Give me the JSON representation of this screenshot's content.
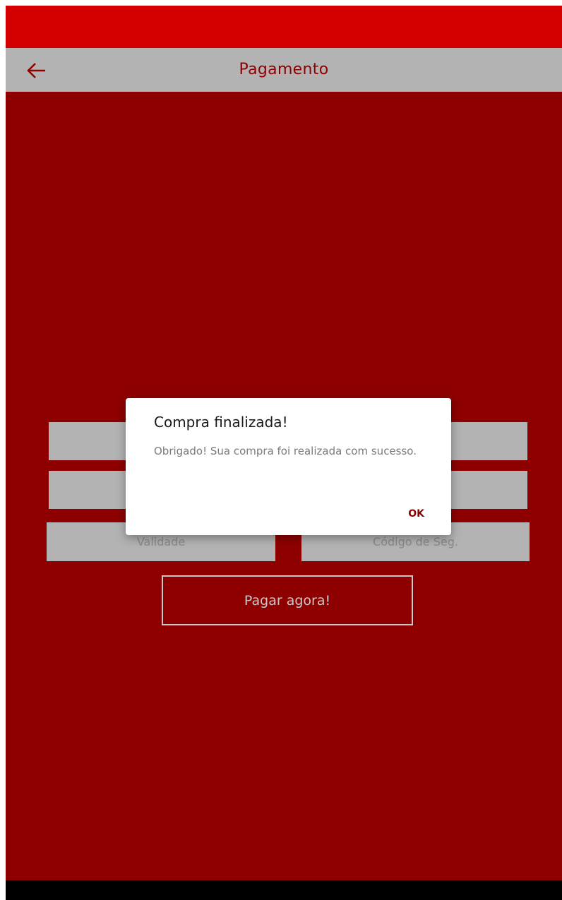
{
  "app_bar": {
    "title": "Pagamento",
    "back_icon": "arrow-left-icon"
  },
  "form": {
    "card_name_placeholder": "",
    "card_number_placeholder": "",
    "validity_placeholder": "Validade",
    "security_code_placeholder": "Código de Seg.",
    "pay_button_label": "Pagar agora!"
  },
  "dialog": {
    "title": "Compra finalizada!",
    "message": "Obrigado! Sua compra foi realizada com sucesso.",
    "ok_label": "OK"
  },
  "colors": {
    "status_bar": "#d40000",
    "background": "#8e0000",
    "app_bar": "#b3b3b3",
    "accent": "#8e0000"
  }
}
